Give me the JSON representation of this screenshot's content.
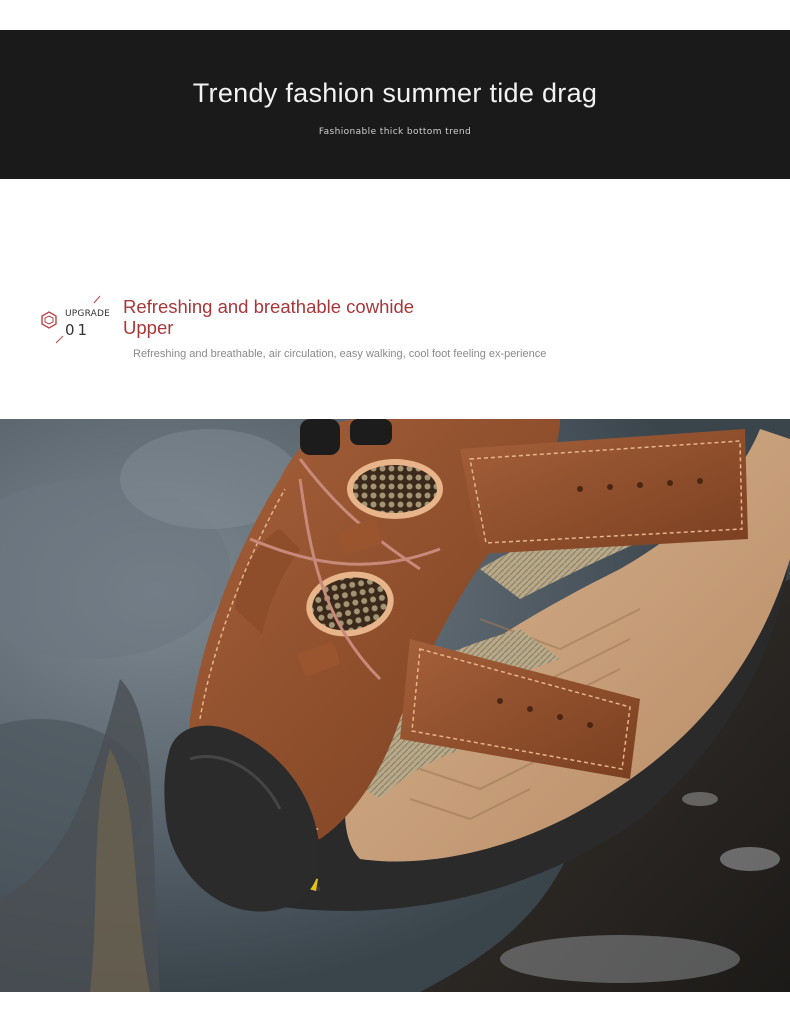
{
  "banner": {
    "title": "Trendy fashion summer tide drag",
    "subtitle": "Fashionable thick bottom trend"
  },
  "feature": {
    "badge_label": "UPGRADE",
    "badge_number": "01",
    "title": "Refreshing and breathable cowhide Upper",
    "description": "Refreshing and breathable, air circulation, easy walking, cool foot feeling ex-perience"
  },
  "photo": {
    "subject": "sandal-photo",
    "colors": {
      "leather": "#8b4a26",
      "sole": "#2a2a2a",
      "footbed": "#c9a27c",
      "stitching": "#e8b48a",
      "background_stone": "#5e6a72",
      "accent_badge": "#e3c21c"
    }
  },
  "colors": {
    "banner_bg": "#1a1a1a",
    "title_accent": "#a8373a",
    "desc_text": "#8a8a8a"
  }
}
